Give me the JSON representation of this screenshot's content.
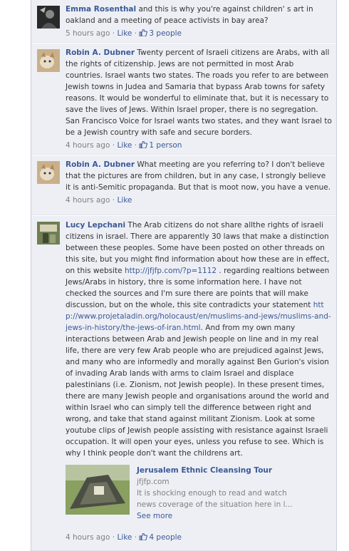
{
  "comments": [
    {
      "author": "Emma Rosenthal",
      "text": "and this is why you're against children' s art in oakland and a meeting of peace activists in bay area?",
      "time": "5 hours ago",
      "like_label": "Like",
      "likes": "3 people"
    },
    {
      "author": "Robin A. Dubner",
      "text": "Twenty percent of Israeli citizens are Arabs, with all the rights of citizenship. Jews are not permitted in most Arab countries. Israel wants two states. The roads you refer to are between Jewish towns in Judea and Samaria that bypass Arab towns for safety reasons. It would be wonderful to eliminate that, but it is necessary to save the lives of Jews. Within Israel proper, there is no segregation. San Francisco Voice for Israel wants two states, and they want Israel to be a Jewish country with safe and secure borders.",
      "time": "4 hours ago",
      "like_label": "Like",
      "likes": "1 person"
    },
    {
      "author": "Robin A. Dubner",
      "text": "What meeting are you referring to? I don't believe that the pictures are from children, but in any case, I strongly believe it is anti-Semitic propaganda. But that is moot now, you have a venue.",
      "time": "4 hours ago",
      "like_label": "Like"
    },
    {
      "author": "Lucy Lepchani",
      "text_1": "The Arab citizens do not share allthe rights of israeli citizens in israel. There are apparently 30 laws that make a distinction between these peoples. Some have been posted on other threads on this site, but you might find information about how these are in effect, on this website",
      "link_1": "http://jfjfp.com/?p=1112",
      "text_2": ". regarding realtions between Jews/Arabs in history, thre is some information here. I have not checked the sources and I'm sure there are points that will make discussion, but on the whole, this site contradicts your statement",
      "link_2": "http://www.projetaladin.org/holocaust/en/muslims-and-jews/muslims-and-jews-in-history/the-jews-of-iran.html",
      "text_3": ". And from my own many interactions between Arab and Jewish people on line and in my real life, there are very few Arab people who are prejudiced against Jews, and many who are informedly and morally against Ben Gurion's vision of invading Arab lands with arms to claim Israel and displace palestinians (i.e. Zionism, not Jewish people). In these present times, there are many Jewish people and organisations around the world and within Israel who can simply tell the difference between right and wrong, and take that stand against militant Zionism. Look at some youtube clips of Jewish people assisting with resistance against Israeli occupation. It will open your eyes, unless you refuse to see. Which is why I think people don't want the childrens art.",
      "attachment": {
        "title": "Jerusalem Ethnic Cleansing Tour",
        "domain": "jfjfp.com",
        "description": "It is shocking enough to read and watch news coverage of the situation here in l...",
        "see_more": "See more"
      },
      "time": "4 hours ago",
      "like_label": "Like",
      "likes": "4 people"
    }
  ],
  "separator": "·"
}
